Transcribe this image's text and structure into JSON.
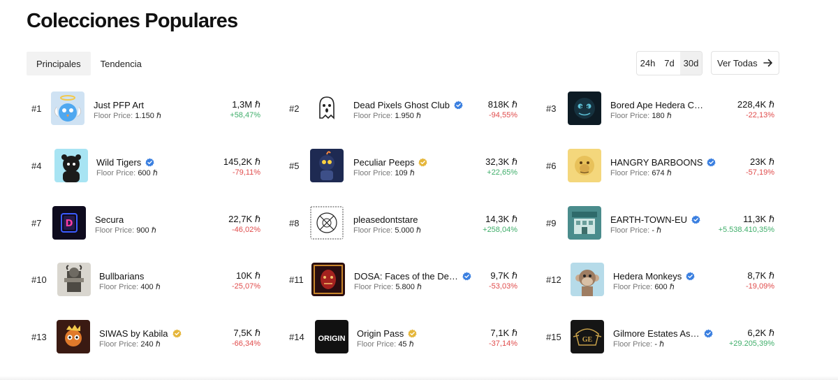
{
  "title": "Colecciones Populares",
  "tabs": [
    {
      "label": "Principales",
      "active": true
    },
    {
      "label": "Tendencia",
      "active": false
    }
  ],
  "periods": [
    {
      "label": "24h",
      "active": false
    },
    {
      "label": "7d",
      "active": false
    },
    {
      "label": "30d",
      "active": true
    }
  ],
  "view_all": {
    "label": "Ver Todas",
    "icon": "arrow-right-icon"
  },
  "floor_label": "Floor Price:",
  "currency_symbol": "ℏ",
  "colors": {
    "up": "#3fae6a",
    "down": "#e04b4b",
    "verified_blue": "#3a7fe0",
    "verified_gold": "#e5b63b"
  },
  "collections": [
    {
      "rank": "#1",
      "name": "Just PFP Art",
      "badge": "",
      "floor": "1.150",
      "volume": "1,3M",
      "change": "+58,47%",
      "dir": "up",
      "thumb": "angel-bird"
    },
    {
      "rank": "#2",
      "name": "Dead Pixels Ghost Club",
      "badge": "blue",
      "floor": "1.950",
      "volume": "818K",
      "change": "-94,55%",
      "dir": "down",
      "thumb": "ghost"
    },
    {
      "rank": "#3",
      "name": "Bored Ape Hedera Club",
      "badge": "",
      "floor": "180",
      "volume": "228,4K",
      "change": "-22,13%",
      "dir": "down",
      "thumb": "ape-dark"
    },
    {
      "rank": "#4",
      "name": "Wild Tigers",
      "badge": "blue",
      "floor": "600",
      "volume": "145,2K",
      "change": "-79,11%",
      "dir": "down",
      "thumb": "tiger"
    },
    {
      "rank": "#5",
      "name": "Peculiar Peeps",
      "badge": "gold",
      "floor": "109",
      "volume": "32,3K",
      "change": "+22,65%",
      "dir": "up",
      "thumb": "peep"
    },
    {
      "rank": "#6",
      "name": "HANGRY BARBOONS",
      "badge": "blue",
      "floor": "674",
      "volume": "23K",
      "change": "-57,19%",
      "dir": "down",
      "thumb": "baboon"
    },
    {
      "rank": "#7",
      "name": "Secura",
      "badge": "",
      "floor": "900",
      "volume": "22,7K",
      "change": "-46,02%",
      "dir": "down",
      "thumb": "secura"
    },
    {
      "rank": "#8",
      "name": "pleasedontstare",
      "badge": "",
      "floor": "5.000",
      "volume": "14,3K",
      "change": "+258,04%",
      "dir": "up",
      "thumb": "sketch"
    },
    {
      "rank": "#9",
      "name": "EARTH-TOWN-EU",
      "badge": "blue",
      "floor": "-",
      "volume": "11,3K",
      "change": "+5.538.410,35%",
      "dir": "up",
      "thumb": "town"
    },
    {
      "rank": "#10",
      "name": "Bullbarians",
      "badge": "",
      "floor": "400",
      "volume": "10K",
      "change": "-25,07%",
      "dir": "down",
      "thumb": "bull"
    },
    {
      "rank": "#11",
      "name": "DOSA: Faces of the De…",
      "badge": "blue",
      "floor": "5.800",
      "volume": "9,7K",
      "change": "-53,03%",
      "dir": "down",
      "thumb": "dosa"
    },
    {
      "rank": "#12",
      "name": "Hedera Monkeys",
      "badge": "blue",
      "floor": "600",
      "volume": "8,7K",
      "change": "-19,09%",
      "dir": "down",
      "thumb": "monkey"
    },
    {
      "rank": "#13",
      "name": "SIWAS by Kabila",
      "badge": "gold",
      "floor": "240",
      "volume": "7,5K",
      "change": "-66,34%",
      "dir": "down",
      "thumb": "siwas"
    },
    {
      "rank": "#14",
      "name": "Origin Pass",
      "badge": "gold",
      "floor": "45",
      "volume": "7,1K",
      "change": "-37,14%",
      "dir": "down",
      "thumb": "origin",
      "thumb_text": "ORIGIN"
    },
    {
      "rank": "#15",
      "name": "Gilmore Estates As…",
      "badge": "blue",
      "floor": "-",
      "volume": "6,2K",
      "change": "+29.205,39%",
      "dir": "up",
      "thumb": "gilmore",
      "thumb_text": "GE"
    }
  ]
}
